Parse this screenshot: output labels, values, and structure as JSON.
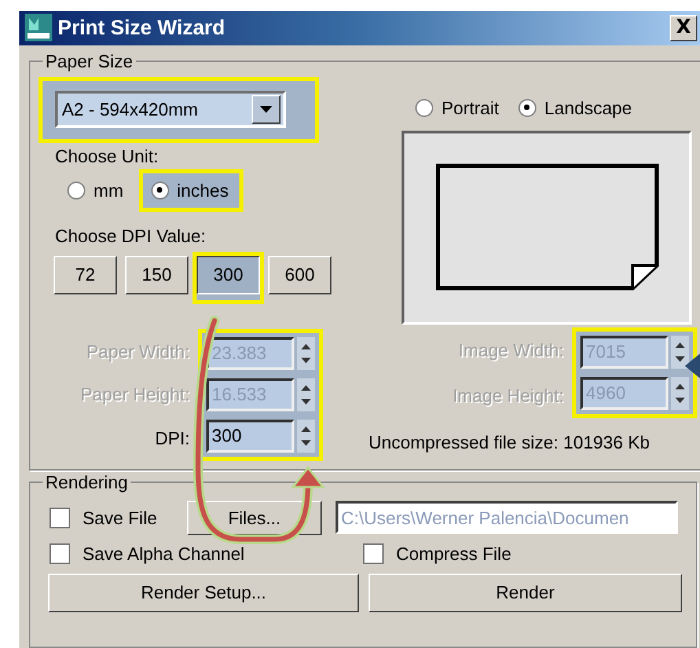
{
  "window": {
    "title": "Print Size Wizard",
    "close": "X"
  },
  "paper_size": {
    "legend": "Paper Size",
    "value": "A2 - 594x420mm",
    "highlighted": true
  },
  "unit": {
    "label": "Choose Unit:",
    "options": [
      {
        "label": "mm",
        "selected": false,
        "highlighted": false
      },
      {
        "label": "inches",
        "selected": true,
        "highlighted": true
      }
    ]
  },
  "orientation": [
    {
      "label": "Portrait",
      "selected": false
    },
    {
      "label": "Landscape",
      "selected": true
    }
  ],
  "dpi": {
    "label": "Choose DPI Value:",
    "buttons": [
      {
        "label": "72",
        "selected": false,
        "highlighted": false
      },
      {
        "label": "150",
        "selected": false,
        "highlighted": false
      },
      {
        "label": "300",
        "selected": true,
        "highlighted": true
      },
      {
        "label": "600",
        "selected": false,
        "highlighted": false
      }
    ]
  },
  "size_fields": {
    "highlighted": true,
    "fields": [
      {
        "label": "Paper Width:",
        "value": "23.383",
        "disabled": true
      },
      {
        "label": "Paper Height:",
        "value": "16.533",
        "disabled": true
      },
      {
        "label": "DPI:",
        "value": "300",
        "disabled": false
      }
    ]
  },
  "image_fields": {
    "highlighted": true,
    "fields": [
      {
        "label": "Image Width:",
        "value": "7015",
        "disabled": true
      },
      {
        "label": "Image Height:",
        "value": "4960",
        "disabled": true
      }
    ]
  },
  "file_size": "Uncompressed file size: 101936 Kb",
  "rendering": {
    "legend": "Rendering",
    "save_file": {
      "label": "Save File",
      "checked": false
    },
    "files_button": "Files...",
    "path": "C:\\Users\\Werner Palencia\\Documen",
    "save_alpha": {
      "label": "Save Alpha Channel",
      "checked": false
    },
    "compress": {
      "label": "Compress File",
      "checked": false
    },
    "buttons": [
      "Render Setup...",
      "Render"
    ]
  }
}
